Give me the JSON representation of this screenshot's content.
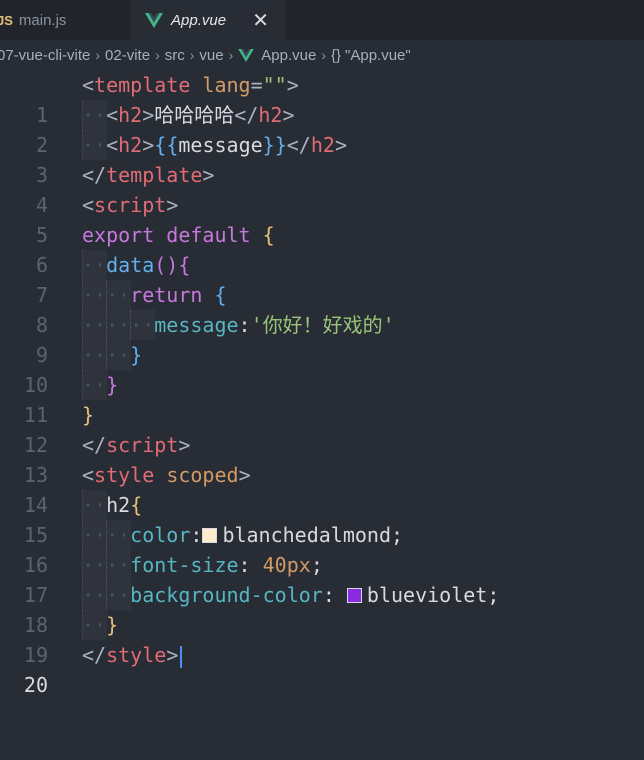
{
  "tabs": {
    "main_js": {
      "icon_text": "JS",
      "label": "main.js"
    },
    "app_vue": {
      "label": "App.vue",
      "close_glyph": "✕"
    }
  },
  "breadcrumb": {
    "segments": [
      "07-vue-cli-vite",
      "02-vite",
      "src",
      "vue",
      "App.vue"
    ],
    "symbol": "\"App.vue\"",
    "symbol_icon": "{}"
  },
  "editor": {
    "active_line": 20,
    "line_numbers": [
      "1",
      "2",
      "3",
      "4",
      "5",
      "6",
      "7",
      "8",
      "9",
      "10",
      "11",
      "12",
      "13",
      "14",
      "15",
      "16",
      "17",
      "18",
      "19",
      "20"
    ],
    "colors": {
      "blanchedalmond": "#ffebcd",
      "blueviolet": "#8a2be2"
    },
    "tokens": {
      "template": "template",
      "lang_attr": "lang",
      "lang_val": "\"\"",
      "h2": "h2",
      "h2_text": "哈哈哈哈",
      "mustache_open": "{{",
      "message_var": "message",
      "mustache_close": "}}",
      "script": "script",
      "export": "export",
      "default": "default",
      "data_fn": "data",
      "return": "return",
      "message_key": "message",
      "message_val": "'你好！好戏的'",
      "style": "style",
      "scoped": "scoped",
      "selector": "h2",
      "prop_color": "color",
      "val_color": "blanchedalmond",
      "prop_font_size": "font-size",
      "val_font_size": "40px",
      "prop_bg": "background-color",
      "val_bg": "blueviolet"
    }
  }
}
